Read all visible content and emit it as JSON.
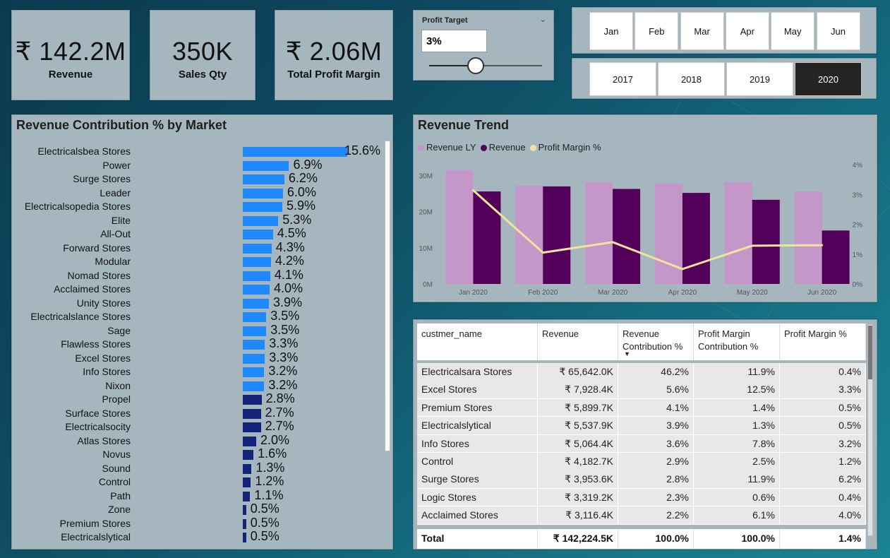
{
  "kpis": {
    "revenue": {
      "value": "₹ 142.2M",
      "label": "Revenue"
    },
    "sales_qty": {
      "value": "350K",
      "label": "Sales Qty"
    },
    "profit_margin": {
      "value": "₹ 2.06M",
      "label": "Total Profit Margin"
    }
  },
  "profit_target": {
    "title": "Profit Target",
    "value": "3%",
    "slider_fraction": 0.41
  },
  "months": {
    "items": [
      "Jan",
      "Feb",
      "Mar",
      "Apr",
      "May",
      "Jun"
    ]
  },
  "years": {
    "items": [
      "2017",
      "2018",
      "2019",
      "2020"
    ],
    "selected": "2020"
  },
  "market_panel": {
    "title": "Revenue Contribution % by Market",
    "colors": {
      "top": "#1e88ff",
      "low": "#13237a"
    },
    "items": [
      {
        "name": "Electricalsbea Stores",
        "pct": 15.6,
        "label": "15.6%"
      },
      {
        "name": "Power",
        "pct": 6.9,
        "label": "6.9%"
      },
      {
        "name": "Surge Stores",
        "pct": 6.2,
        "label": "6.2%"
      },
      {
        "name": "Leader",
        "pct": 6.0,
        "label": "6.0%"
      },
      {
        "name": "Electricalsopedia Stores",
        "pct": 5.9,
        "label": "5.9%"
      },
      {
        "name": "Elite",
        "pct": 5.3,
        "label": "5.3%"
      },
      {
        "name": "All-Out",
        "pct": 4.5,
        "label": "4.5%"
      },
      {
        "name": "Forward Stores",
        "pct": 4.3,
        "label": "4.3%"
      },
      {
        "name": "Modular",
        "pct": 4.2,
        "label": "4.2%"
      },
      {
        "name": "Nomad Stores",
        "pct": 4.1,
        "label": "4.1%"
      },
      {
        "name": "Acclaimed Stores",
        "pct": 4.0,
        "label": "4.0%"
      },
      {
        "name": "Unity Stores",
        "pct": 3.9,
        "label": "3.9%"
      },
      {
        "name": "Electricalslance Stores",
        "pct": 3.5,
        "label": "3.5%"
      },
      {
        "name": "Sage",
        "pct": 3.5,
        "label": "3.5%"
      },
      {
        "name": "Flawless Stores",
        "pct": 3.3,
        "label": "3.3%"
      },
      {
        "name": "Excel Stores",
        "pct": 3.3,
        "label": "3.3%"
      },
      {
        "name": "Info Stores",
        "pct": 3.2,
        "label": "3.2%"
      },
      {
        "name": "Nixon",
        "pct": 3.2,
        "label": "3.2%"
      },
      {
        "name": "Propel",
        "pct": 2.8,
        "label": "2.8%"
      },
      {
        "name": "Surface Stores",
        "pct": 2.7,
        "label": "2.7%"
      },
      {
        "name": "Electricalsocity",
        "pct": 2.7,
        "label": "2.7%"
      },
      {
        "name": "Atlas Stores",
        "pct": 2.0,
        "label": "2.0%"
      },
      {
        "name": "Novus",
        "pct": 1.6,
        "label": "1.6%"
      },
      {
        "name": "Sound",
        "pct": 1.3,
        "label": "1.3%"
      },
      {
        "name": "Control",
        "pct": 1.2,
        "label": "1.2%"
      },
      {
        "name": "Path",
        "pct": 1.1,
        "label": "1.1%"
      },
      {
        "name": "Zone",
        "pct": 0.5,
        "label": "0.5%"
      },
      {
        "name": "Premium Stores",
        "pct": 0.5,
        "label": "0.5%"
      },
      {
        "name": "Electricalslytical",
        "pct": 0.5,
        "label": "0.5%"
      }
    ]
  },
  "trend_panel": {
    "title": "Revenue Trend",
    "legend": [
      "Revenue LY",
      "Revenue",
      "Profit Margin %"
    ],
    "colors": {
      "revenue_ly": "#c596c9",
      "revenue": "#52005a",
      "margin": "#f2e39c"
    }
  },
  "chart_data": {
    "type": "bar",
    "categories": [
      "Jan 2020",
      "Feb 2020",
      "Mar 2020",
      "Apr 2020",
      "May 2020",
      "Jun 2020"
    ],
    "series": [
      {
        "name": "Revenue LY",
        "values": [
          31.5,
          27.2,
          28.2,
          27.8,
          28.2,
          25.6
        ]
      },
      {
        "name": "Revenue",
        "values": [
          25.6,
          27.0,
          26.3,
          25.2,
          23.3,
          14.8
        ]
      },
      {
        "name": "Profit Margin %",
        "values": [
          3.14,
          1.05,
          1.4,
          0.5,
          1.28,
          1.3
        ]
      }
    ],
    "y_ticks": [
      "0M",
      "10M",
      "20M",
      "30M"
    ],
    "y2_ticks": [
      "0%",
      "1%",
      "2%",
      "3%",
      "4%"
    ],
    "ylim": [
      0,
      35
    ],
    "y2lim": [
      0,
      4
    ]
  },
  "table": {
    "headers": [
      "custmer_name",
      "Revenue",
      "Revenue Contribution %",
      "Profit Margin Contribution %",
      "Profit Margin %"
    ],
    "rows": [
      [
        "Electricalsara Stores",
        "₹ 65,642.0K",
        "46.2%",
        "11.9%",
        "0.4%"
      ],
      [
        "Excel Stores",
        "₹ 7,928.4K",
        "5.6%",
        "12.5%",
        "3.3%"
      ],
      [
        "Premium Stores",
        "₹ 5,899.7K",
        "4.1%",
        "1.4%",
        "0.5%"
      ],
      [
        "Electricalslytical",
        "₹ 5,537.9K",
        "3.9%",
        "1.3%",
        "0.5%"
      ],
      [
        "Info Stores",
        "₹ 5,064.4K",
        "3.6%",
        "7.8%",
        "3.2%"
      ],
      [
        "Control",
        "₹ 4,182.7K",
        "2.9%",
        "2.5%",
        "1.2%"
      ],
      [
        "Surge Stores",
        "₹ 3,953.6K",
        "2.8%",
        "11.9%",
        "6.2%"
      ],
      [
        "Logic Stores",
        "₹ 3,319.2K",
        "2.3%",
        "0.6%",
        "0.4%"
      ],
      [
        "Acclaimed Stores",
        "₹ 3,116.4K",
        "2.2%",
        "6.1%",
        "4.0%"
      ]
    ],
    "total": [
      "Total",
      "₹ 142,224.5K",
      "100.0%",
      "100.0%",
      "1.4%"
    ]
  }
}
